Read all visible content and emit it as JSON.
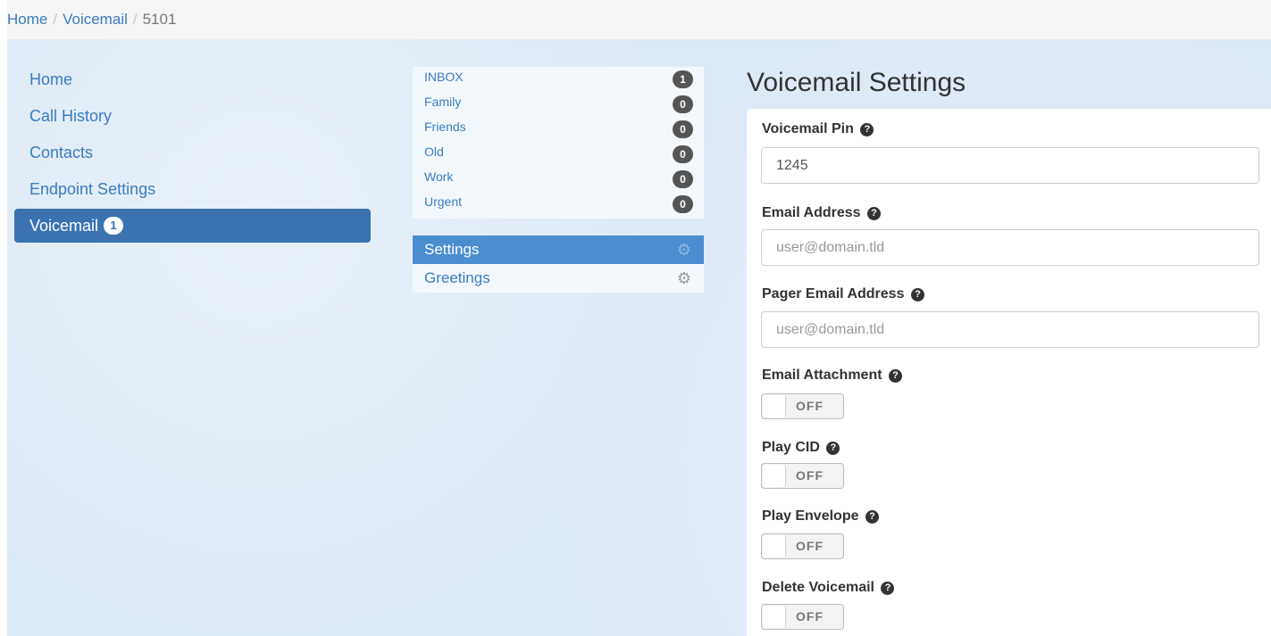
{
  "breadcrumb": {
    "home": "Home",
    "voicemail": "Voicemail",
    "current": "5101",
    "separator": "/"
  },
  "nav": {
    "items": [
      {
        "label": "Home"
      },
      {
        "label": "Call History"
      },
      {
        "label": "Contacts"
      },
      {
        "label": "Endpoint Settings"
      },
      {
        "label": "Voicemail",
        "badge": "1",
        "active": true
      }
    ]
  },
  "folders": [
    {
      "label": "INBOX",
      "count": "1"
    },
    {
      "label": "Family",
      "count": "0"
    },
    {
      "label": "Friends",
      "count": "0"
    },
    {
      "label": "Old",
      "count": "0"
    },
    {
      "label": "Work",
      "count": "0"
    },
    {
      "label": "Urgent",
      "count": "0"
    }
  ],
  "settings_menu": [
    {
      "label": "Settings",
      "icon": "gear-icon",
      "active": true
    },
    {
      "label": "Greetings",
      "icon": "gear-icon"
    }
  ],
  "main": {
    "title": "Voicemail Settings",
    "help_glyph": "?",
    "fields": {
      "pin": {
        "label": "Voicemail Pin",
        "value": "1245"
      },
      "email": {
        "label": "Email Address",
        "placeholder": "user@domain.tld"
      },
      "pager_email": {
        "label": "Pager Email Address",
        "placeholder": "user@domain.tld"
      },
      "email_attachment": {
        "label": "Email Attachment",
        "state": "OFF"
      },
      "play_cid": {
        "label": "Play CID",
        "state": "OFF"
      },
      "play_envelope": {
        "label": "Play Envelope",
        "state": "OFF"
      },
      "delete_voicemail": {
        "label": "Delete Voicemail",
        "state": "OFF"
      }
    }
  },
  "colors": {
    "accent": "#3a73b0",
    "link": "#3a7cc0",
    "background": "#dce9f6"
  }
}
